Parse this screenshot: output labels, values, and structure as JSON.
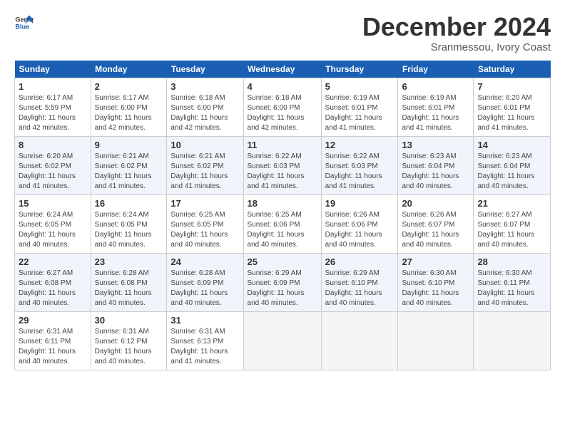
{
  "header": {
    "logo_line1": "General",
    "logo_line2": "Blue",
    "month": "December 2024",
    "location": "Sranmessou, Ivory Coast"
  },
  "days_of_week": [
    "Sunday",
    "Monday",
    "Tuesday",
    "Wednesday",
    "Thursday",
    "Friday",
    "Saturday"
  ],
  "weeks": [
    [
      {
        "day": "1",
        "info": "Sunrise: 6:17 AM\nSunset: 5:59 PM\nDaylight: 11 hours\nand 42 minutes."
      },
      {
        "day": "2",
        "info": "Sunrise: 6:17 AM\nSunset: 6:00 PM\nDaylight: 11 hours\nand 42 minutes."
      },
      {
        "day": "3",
        "info": "Sunrise: 6:18 AM\nSunset: 6:00 PM\nDaylight: 11 hours\nand 42 minutes."
      },
      {
        "day": "4",
        "info": "Sunrise: 6:18 AM\nSunset: 6:00 PM\nDaylight: 11 hours\nand 42 minutes."
      },
      {
        "day": "5",
        "info": "Sunrise: 6:19 AM\nSunset: 6:01 PM\nDaylight: 11 hours\nand 41 minutes."
      },
      {
        "day": "6",
        "info": "Sunrise: 6:19 AM\nSunset: 6:01 PM\nDaylight: 11 hours\nand 41 minutes."
      },
      {
        "day": "7",
        "info": "Sunrise: 6:20 AM\nSunset: 6:01 PM\nDaylight: 11 hours\nand 41 minutes."
      }
    ],
    [
      {
        "day": "8",
        "info": "Sunrise: 6:20 AM\nSunset: 6:02 PM\nDaylight: 11 hours\nand 41 minutes."
      },
      {
        "day": "9",
        "info": "Sunrise: 6:21 AM\nSunset: 6:02 PM\nDaylight: 11 hours\nand 41 minutes."
      },
      {
        "day": "10",
        "info": "Sunrise: 6:21 AM\nSunset: 6:02 PM\nDaylight: 11 hours\nand 41 minutes."
      },
      {
        "day": "11",
        "info": "Sunrise: 6:22 AM\nSunset: 6:03 PM\nDaylight: 11 hours\nand 41 minutes."
      },
      {
        "day": "12",
        "info": "Sunrise: 6:22 AM\nSunset: 6:03 PM\nDaylight: 11 hours\nand 41 minutes."
      },
      {
        "day": "13",
        "info": "Sunrise: 6:23 AM\nSunset: 6:04 PM\nDaylight: 11 hours\nand 40 minutes."
      },
      {
        "day": "14",
        "info": "Sunrise: 6:23 AM\nSunset: 6:04 PM\nDaylight: 11 hours\nand 40 minutes."
      }
    ],
    [
      {
        "day": "15",
        "info": "Sunrise: 6:24 AM\nSunset: 6:05 PM\nDaylight: 11 hours\nand 40 minutes."
      },
      {
        "day": "16",
        "info": "Sunrise: 6:24 AM\nSunset: 6:05 PM\nDaylight: 11 hours\nand 40 minutes."
      },
      {
        "day": "17",
        "info": "Sunrise: 6:25 AM\nSunset: 6:05 PM\nDaylight: 11 hours\nand 40 minutes."
      },
      {
        "day": "18",
        "info": "Sunrise: 6:25 AM\nSunset: 6:06 PM\nDaylight: 11 hours\nand 40 minutes."
      },
      {
        "day": "19",
        "info": "Sunrise: 6:26 AM\nSunset: 6:06 PM\nDaylight: 11 hours\nand 40 minutes."
      },
      {
        "day": "20",
        "info": "Sunrise: 6:26 AM\nSunset: 6:07 PM\nDaylight: 11 hours\nand 40 minutes."
      },
      {
        "day": "21",
        "info": "Sunrise: 6:27 AM\nSunset: 6:07 PM\nDaylight: 11 hours\nand 40 minutes."
      }
    ],
    [
      {
        "day": "22",
        "info": "Sunrise: 6:27 AM\nSunset: 6:08 PM\nDaylight: 11 hours\nand 40 minutes."
      },
      {
        "day": "23",
        "info": "Sunrise: 6:28 AM\nSunset: 6:08 PM\nDaylight: 11 hours\nand 40 minutes."
      },
      {
        "day": "24",
        "info": "Sunrise: 6:28 AM\nSunset: 6:09 PM\nDaylight: 11 hours\nand 40 minutes."
      },
      {
        "day": "25",
        "info": "Sunrise: 6:29 AM\nSunset: 6:09 PM\nDaylight: 11 hours\nand 40 minutes."
      },
      {
        "day": "26",
        "info": "Sunrise: 6:29 AM\nSunset: 6:10 PM\nDaylight: 11 hours\nand 40 minutes."
      },
      {
        "day": "27",
        "info": "Sunrise: 6:30 AM\nSunset: 6:10 PM\nDaylight: 11 hours\nand 40 minutes."
      },
      {
        "day": "28",
        "info": "Sunrise: 6:30 AM\nSunset: 6:11 PM\nDaylight: 11 hours\nand 40 minutes."
      }
    ],
    [
      {
        "day": "29",
        "info": "Sunrise: 6:31 AM\nSunset: 6:11 PM\nDaylight: 11 hours\nand 40 minutes."
      },
      {
        "day": "30",
        "info": "Sunrise: 6:31 AM\nSunset: 6:12 PM\nDaylight: 11 hours\nand 40 minutes."
      },
      {
        "day": "31",
        "info": "Sunrise: 6:31 AM\nSunset: 6:13 PM\nDaylight: 11 hours\nand 41 minutes."
      },
      {
        "day": "",
        "info": ""
      },
      {
        "day": "",
        "info": ""
      },
      {
        "day": "",
        "info": ""
      },
      {
        "day": "",
        "info": ""
      }
    ]
  ]
}
